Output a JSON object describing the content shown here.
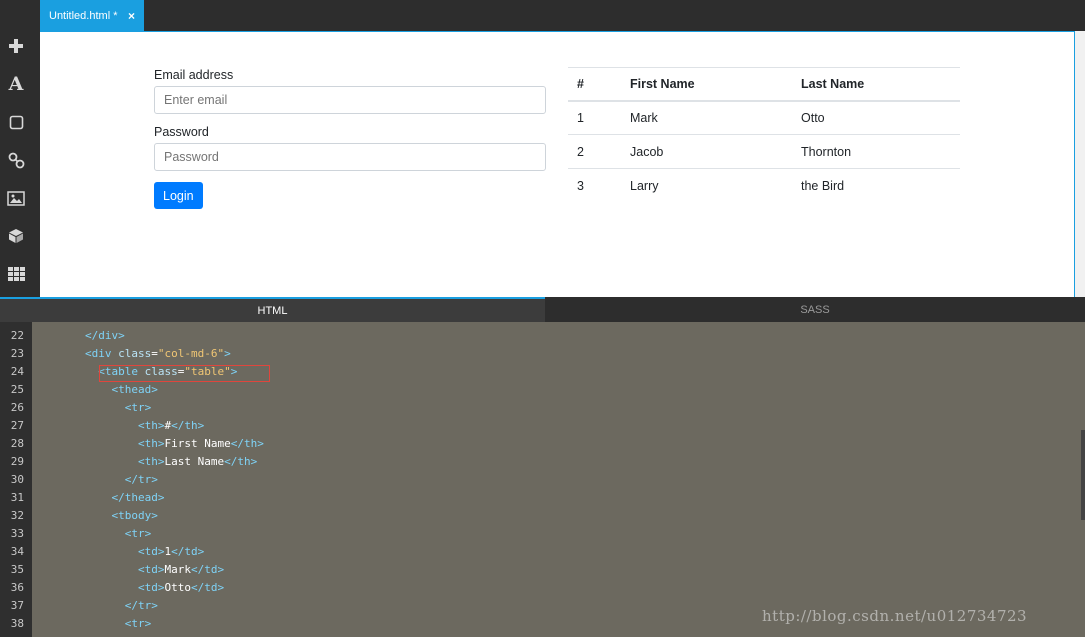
{
  "editor": {
    "tab_title": "Untitled.html *",
    "tab_close_icon": "×"
  },
  "sidebar_icons": [
    "plus-icon",
    "text-icon",
    "box-icon",
    "link-icon",
    "image-icon",
    "component-icon",
    "grid-icon"
  ],
  "preview": {
    "form": {
      "email_label": "Email address",
      "email_placeholder": "Enter email",
      "password_label": "Password",
      "password_placeholder": "Password",
      "login_button": "Login"
    },
    "table": {
      "headers": [
        "#",
        "First Name",
        "Last Name"
      ],
      "rows": [
        [
          "1",
          "Mark",
          "Otto"
        ],
        [
          "2",
          "Jacob",
          "Thornton"
        ],
        [
          "3",
          "Larry",
          "the Bird"
        ]
      ]
    }
  },
  "panel_tabs": {
    "html": "HTML",
    "sass": "SASS"
  },
  "code": {
    "line_numbers": [
      "22",
      "23",
      "24",
      "25",
      "26",
      "27",
      "28",
      "29",
      "30",
      "31",
      "32",
      "33",
      "34",
      "35",
      "36",
      "37",
      "38"
    ]
  },
  "watermark": "http://blog.csdn.net/u012734723",
  "colors": {
    "accent": "#1a9fe0",
    "button": "#007bff",
    "highlight_box": "#e0463d"
  }
}
